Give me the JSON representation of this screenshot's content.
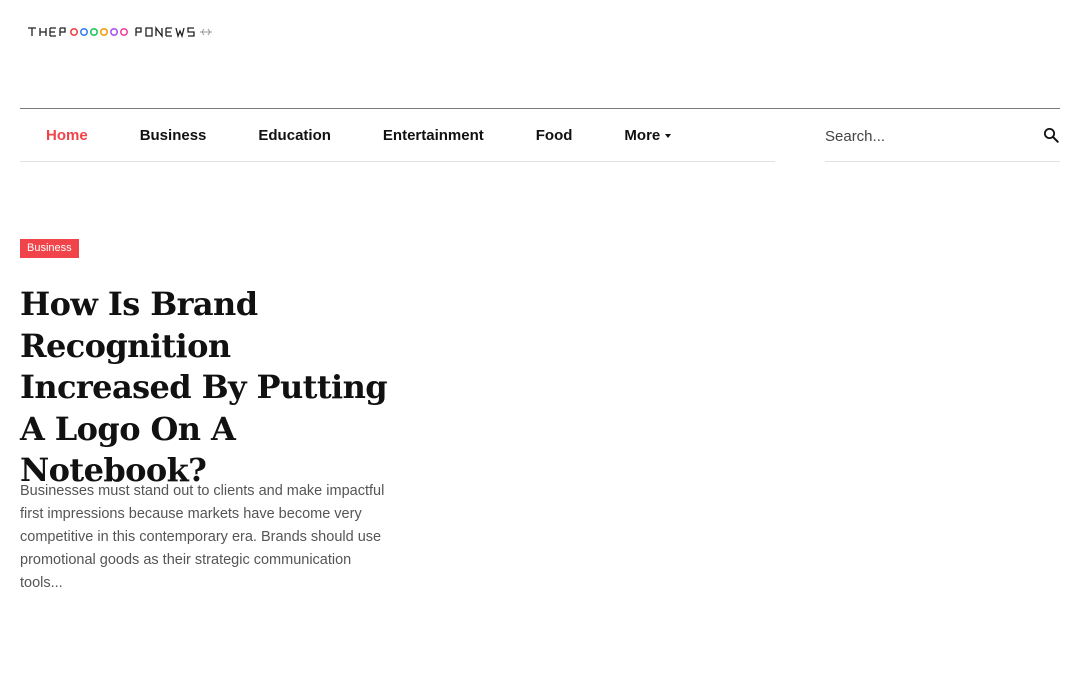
{
  "site": {
    "logo_text": "THEPRODUCTNEWS"
  },
  "nav": {
    "items": [
      {
        "label": "Home",
        "active": true
      },
      {
        "label": "Business"
      },
      {
        "label": "Education"
      },
      {
        "label": "Entertainment"
      },
      {
        "label": "Food"
      },
      {
        "label": "More"
      }
    ]
  },
  "search": {
    "placeholder": "Search...",
    "icon": "search-icon"
  },
  "article": {
    "category": "Business",
    "title": "How Is Brand Recognition Increased By Putting A Logo On A Notebook?",
    "excerpt": "Businesses must stand out to clients and make impactful first impressions because markets have become very competitive in this contemporary era. Brands should use promotional goods as their strategic communication tools..."
  },
  "colors": {
    "accent": "#f0444a",
    "text": "#111111",
    "muted": "#555555"
  }
}
